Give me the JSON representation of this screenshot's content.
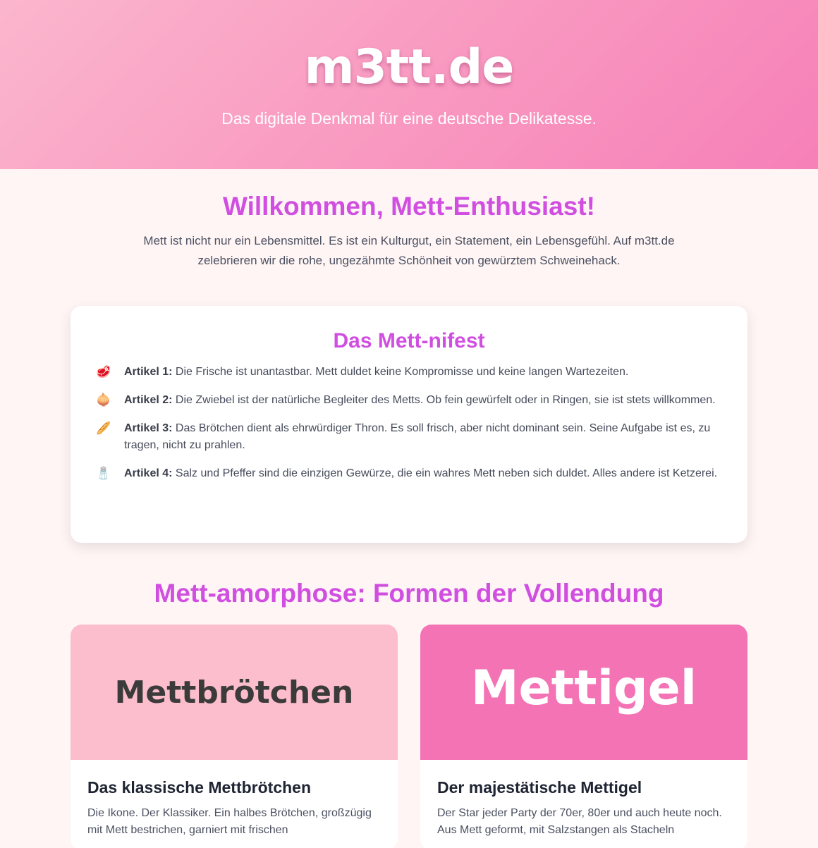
{
  "header": {
    "title": "m3tt.de",
    "subtitle": "Das digitale Denkmal für eine deutsche Delikatesse."
  },
  "intro": {
    "title": "Willkommen, Mett-Enthusiast!",
    "text": "Mett ist nicht nur ein Lebensmittel. Es ist ein Kulturgut, ein Statement, ein Lebensgefühl. Auf m3tt.de zelebrieren wir die rohe, ungezähmte Schönheit von gewürztem Schweinehack."
  },
  "manifest": {
    "title": "Das Mett-nifest",
    "articles": [
      {
        "icon": "meat-icon",
        "glyph": "🥩",
        "label": "Artikel 1:",
        "text": "Die Frische ist unantastbar. Mett duldet keine Kompromisse und keine langen Wartezeiten."
      },
      {
        "icon": "onion-icon",
        "glyph": "🧅",
        "label": "Artikel 2:",
        "text": "Die Zwiebel ist der natürliche Begleiter des Metts. Ob fein gewürfelt oder in Ringen, sie ist stets willkommen."
      },
      {
        "icon": "bread-icon",
        "glyph": "🥖",
        "label": "Artikel 3:",
        "text": "Das Brötchen dient als ehrwürdiger Thron. Es soll frisch, aber nicht dominant sein. Seine Aufgabe ist es, zu tragen, nicht zu prahlen."
      },
      {
        "icon": "salt-icon",
        "glyph": "🧂",
        "label": "Artikel 4:",
        "text": "Salz und Pfeffer sind die einzigen Gewürze, die ein wahres Mett neben sich duldet. Alles andere ist Ketzerei."
      }
    ]
  },
  "forms": {
    "title": "Mett-amorphose: Formen der Vollendung",
    "cards": [
      {
        "banner": "Mettbrötchen",
        "title": "Das klassische Mettbrötchen",
        "text": "Die Ikone. Der Klassiker. Ein halbes Brötchen, großzügig mit Mett bestrichen, garniert mit frischen"
      },
      {
        "banner": "Mettigel",
        "title": "Der majestätische Mettigel",
        "text": "Der Star jeder Party der 70er, 80er und auch heute noch. Aus Mett geformt, mit Salzstangen als Stacheln"
      }
    ]
  },
  "colors": {
    "accent": "#d04ee0",
    "hero_start": "#fbb6cd",
    "hero_end": "#f680b8",
    "card_light": "#fcbdcc",
    "card_dark": "#f373b5",
    "background": "#fff5f5"
  }
}
